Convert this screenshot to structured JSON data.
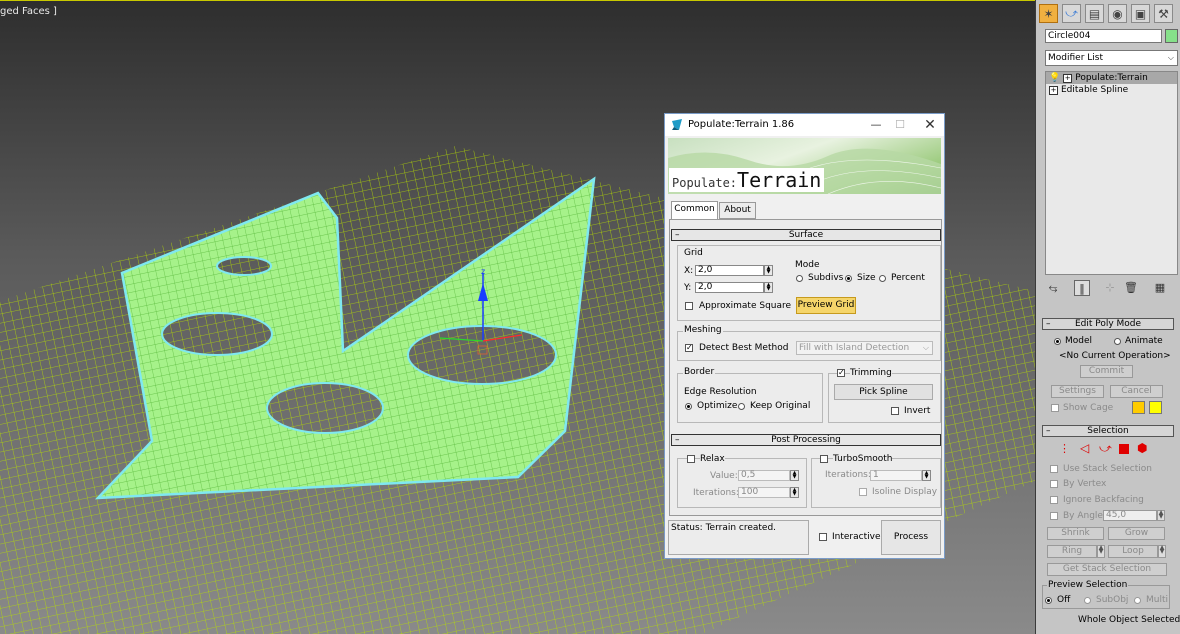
{
  "viewport": {
    "label": "ged Faces ]"
  },
  "dialog": {
    "title": "Populate:Terrain 1.86",
    "banner_prefix": "Populate:",
    "banner_main": "Terrain",
    "tabs": [
      "Common",
      "About"
    ],
    "surface": {
      "header": "Surface",
      "grid_label": "Grid",
      "x_label": "X:",
      "x_value": "2,0",
      "y_label": "Y:",
      "y_value": "2,0",
      "approx_square": "Approximate Square",
      "mode_label": "Mode",
      "modes": [
        "Subdivs",
        "Size",
        "Percent"
      ],
      "preview_grid": "Preview Grid"
    },
    "meshing": {
      "label": "Meshing",
      "detect_best": "Detect Best Method",
      "method_value": "Fill with Island Detection"
    },
    "border": {
      "label": "Border",
      "edge_resolution": "Edge Resolution",
      "optimize": "Optimize",
      "keep_original": "Keep Original",
      "trimming": "Trimming",
      "pick_spline": "Pick Spline",
      "invert": "Invert"
    },
    "post": {
      "header": "Post Processing",
      "relax": "Relax",
      "value_label": "Value:",
      "value": "0,5",
      "iterations_label": "Iterations:",
      "iterations": "100",
      "turbosmooth": "TurboSmooth",
      "ts_iterations_label": "Iterations:",
      "ts_iterations": "1",
      "isoline": "Isoline Display"
    },
    "status": "Status: Terrain created.",
    "interactive": "Interactive",
    "process": "Process"
  },
  "panel": {
    "object_name": "Circle004",
    "object_color": "#86e08a",
    "modifier_list": "Modifier List",
    "stack": [
      "Populate:Terrain",
      "Editable Spline"
    ],
    "edit_poly": {
      "header": "Edit Poly Mode",
      "model": "Model",
      "animate": "Animate",
      "no_op": "<No Current Operation>",
      "commit": "Commit",
      "settings": "Settings",
      "cancel": "Cancel",
      "show_cage": "Show Cage"
    },
    "selection": {
      "header": "Selection",
      "use_stack": "Use Stack Selection",
      "by_vertex": "By Vertex",
      "ignore_backfacing": "Ignore Backfacing",
      "by_angle": "By Angle:",
      "angle_value": "45,0",
      "shrink": "Shrink",
      "grow": "Grow",
      "ring": "Ring",
      "loop": "Loop",
      "get_stack": "Get Stack Selection",
      "preview_label": "Preview Selection",
      "preview_opts": [
        "Off",
        "SubObj",
        "Multi"
      ],
      "whole_object": "Whole Object Selected"
    }
  }
}
